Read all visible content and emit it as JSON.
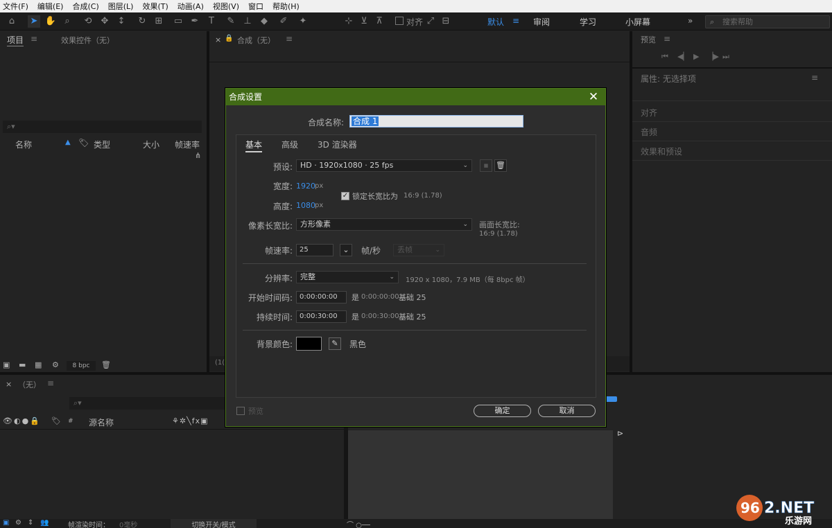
{
  "menu": [
    "文件(F)",
    "编辑(E)",
    "合成(C)",
    "图层(L)",
    "效果(T)",
    "动画(A)",
    "视图(V)",
    "窗口",
    "帮助(H)"
  ],
  "toolbar": {
    "snap_label": "对齐",
    "workspaces": [
      "默认",
      "审阅",
      "学习",
      "小屏幕"
    ],
    "search_placeholder": "搜索帮助"
  },
  "project_panel": {
    "tab_project": "项目",
    "tab_effects": "效果控件（无）",
    "columns": [
      "名称",
      "类型",
      "大小",
      "帧速率"
    ],
    "bpc": "8 bpc"
  },
  "comp_panel": {
    "tab": "合成（无）",
    "zoom_stub": "(1("
  },
  "right_panel": {
    "preview": "预览",
    "properties": "属性: 无选择项",
    "align": "对齐",
    "audio": "音频",
    "effects_presets": "效果和预设"
  },
  "timeline": {
    "tab": "（无）",
    "source_name": "源名称",
    "frame_render_time_label": "帧渲染时间：",
    "frame_render_time_value": "0毫秒",
    "toggle_label": "切换开关/模式"
  },
  "dialog": {
    "title": "合成设置",
    "comp_name_label": "合成名称:",
    "comp_name_value": "合成 1",
    "tabs": [
      "基本",
      "高级",
      "3D 渲染器"
    ],
    "preset_label": "预设:",
    "preset_value": "HD · 1920x1080 · 25 fps",
    "width_label": "宽度:",
    "width_value": "1920",
    "height_label": "高度:",
    "height_value": "1080",
    "px": "px",
    "lock_aspect": "锁定长宽比为",
    "lock_aspect_value": "16:9 (1.78)",
    "par_label": "像素长宽比:",
    "par_value": "方形像素",
    "frame_aspect_label": "画面长宽比:",
    "frame_aspect_value": "16:9 (1.78)",
    "fps_label": "帧速率:",
    "fps_value": "25",
    "fps_unit": "帧/秒",
    "drop_frame": "丢帧",
    "resolution_label": "分辨率:",
    "resolution_value": "完整",
    "resolution_info": "1920 x 1080，7.9 MB（每 8bpc 帧）",
    "start_tc_label": "开始时间码:",
    "start_tc_value": "0:00:00:00",
    "start_tc_info_is": "是",
    "start_tc_info_value": "0:00:00:00",
    "start_tc_base": "基础 25",
    "duration_label": "持续时间:",
    "duration_value": "0:00:30:00",
    "duration_info_is": "是",
    "duration_info_value": "0:00:30:00",
    "duration_base": "基础 25",
    "bg_color_label": "背景颜色:",
    "bg_color_name": "黑色",
    "preview_label": "预览",
    "ok": "确定",
    "cancel": "取消"
  },
  "watermark": {
    "brand": "962.NET",
    "sub": "乐游网"
  },
  "colors": {
    "accent": "#3b8ee8",
    "dialog_title_bg": "#416a16",
    "panel_bg": "#232323"
  }
}
